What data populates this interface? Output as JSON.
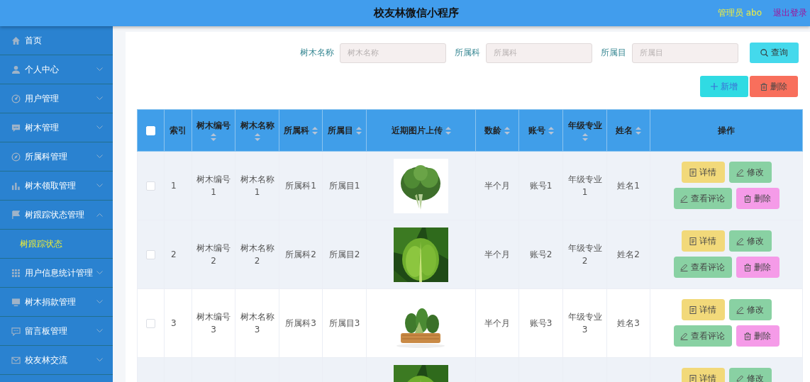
{
  "header": {
    "title": "校友林微信小程序",
    "user": "管理员 abo",
    "logout": "退出登录"
  },
  "sidebar": {
    "items": [
      {
        "label": "首页"
      },
      {
        "label": "个人中心",
        "expanded": false
      },
      {
        "label": "用户管理",
        "expanded": false
      },
      {
        "label": "树木管理",
        "expanded": false
      },
      {
        "label": "所属科管理",
        "expanded": false
      },
      {
        "label": "树木领取管理",
        "expanded": false
      },
      {
        "label": "树跟踪状态管理",
        "expanded": true,
        "children": [
          {
            "label": "树跟踪状态",
            "selected": true
          }
        ]
      },
      {
        "label": "用户信息统计管理",
        "expanded": false
      },
      {
        "label": "树木捐款管理",
        "expanded": false
      },
      {
        "label": "留言板管理",
        "expanded": false
      },
      {
        "label": "校友林交流",
        "expanded": false
      }
    ]
  },
  "search": {
    "fields": [
      {
        "label": "树木名称",
        "placeholder": "树木名称"
      },
      {
        "label": "所属科",
        "placeholder": "所属科"
      },
      {
        "label": "所属目",
        "placeholder": "所属目"
      }
    ],
    "button": "查询"
  },
  "actions": [
    {
      "label": "新增",
      "kind": "add"
    },
    {
      "label": "删除",
      "kind": "delete"
    }
  ],
  "table": {
    "select_all": {
      "checked": false
    },
    "columns": [
      {
        "label": "索引",
        "sortable": false
      },
      {
        "label": "树木编号",
        "sortable": true
      },
      {
        "label": "树木名称",
        "sortable": true
      },
      {
        "label": "所属科",
        "sortable": true
      },
      {
        "label": "所属目",
        "sortable": true
      },
      {
        "label": "近期图片上传",
        "sortable": true
      },
      {
        "label": "数龄",
        "sortable": true
      },
      {
        "label": "账号",
        "sortable": true
      },
      {
        "label": "年级专业",
        "sortable": true
      },
      {
        "label": "姓名",
        "sortable": true
      },
      {
        "label": "操作",
        "sortable": false
      }
    ],
    "rows": [
      {
        "checked": false,
        "highlighted": true,
        "index": "1",
        "code": "树木编号1",
        "name": "树木名称1",
        "family": "所属科1",
        "order": "所属目1",
        "image": {
          "kind": "picture"
        },
        "age": "半个月",
        "account": "账号1",
        "major": "年级专业1",
        "person": "姓名1",
        "actions": [
          {
            "label": "详情",
            "kind": "detail"
          },
          {
            "label": "修改",
            "kind": "edit"
          },
          {
            "label": "查看评论",
            "kind": "comments"
          },
          {
            "label": "删除",
            "kind": "delete"
          }
        ]
      },
      {
        "checked": false,
        "highlighted": true,
        "index": "2",
        "code": "树木编号2",
        "name": "树木名称2",
        "family": "所属科2",
        "order": "所属目2",
        "image": {
          "kind": "picture"
        },
        "age": "半个月",
        "account": "账号2",
        "major": "年级专业2",
        "person": "姓名2",
        "actions": [
          {
            "label": "详情",
            "kind": "detail"
          },
          {
            "label": "修改",
            "kind": "edit"
          },
          {
            "label": "查看评论",
            "kind": "comments"
          },
          {
            "label": "删除",
            "kind": "delete"
          }
        ]
      },
      {
        "checked": false,
        "highlighted": false,
        "index": "3",
        "code": "树木编号3",
        "name": "树木名称3",
        "family": "所属科3",
        "order": "所属目3",
        "image": {
          "kind": "picture"
        },
        "age": "半个月",
        "account": "账号3",
        "major": "年级专业3",
        "person": "姓名3",
        "actions": [
          {
            "label": "详情",
            "kind": "detail"
          },
          {
            "label": "修改",
            "kind": "edit"
          },
          {
            "label": "查看评论",
            "kind": "comments"
          },
          {
            "label": "删除",
            "kind": "delete"
          }
        ]
      },
      {
        "highlighted": true,
        "image": {
          "kind": "picture"
        },
        "actions": [
          {
            "label": "详情",
            "kind": "detail"
          },
          {
            "label": "修改",
            "kind": "edit"
          }
        ]
      }
    ]
  }
}
